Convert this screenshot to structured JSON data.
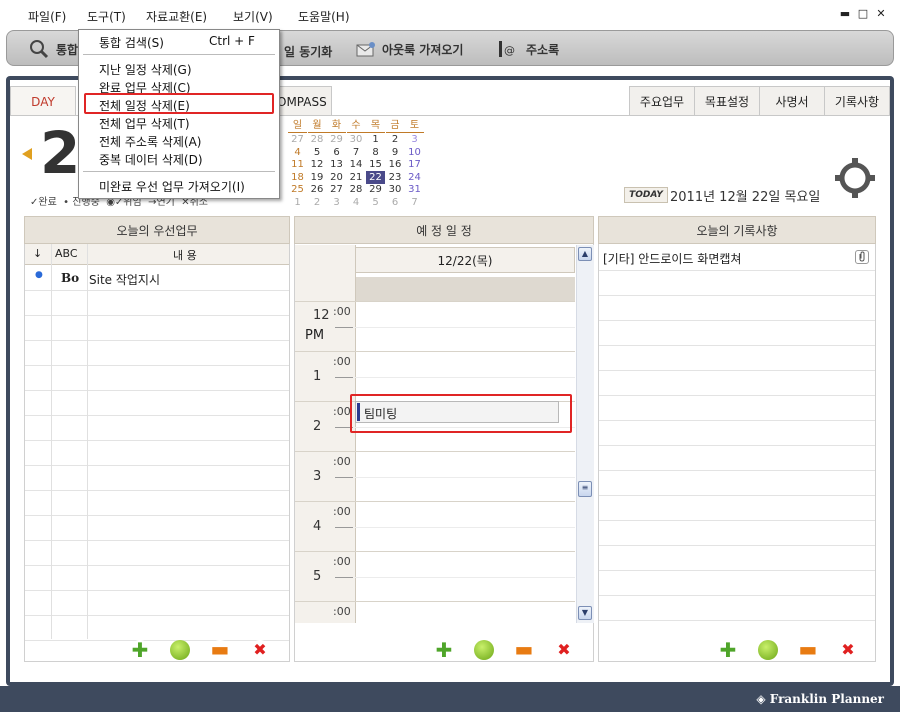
{
  "menubar": {
    "items": [
      "파일(F)",
      "도구(T)",
      "자료교환(E)",
      "보기(V)",
      "도움말(H)"
    ]
  },
  "window_controls": {
    "minimize": "▬",
    "maximize": "□",
    "close": "✕"
  },
  "toolbar": {
    "items": [
      {
        "label": "통합",
        "icon": "search-icon"
      },
      {
        "label": "일 동기화",
        "icon": "sync-icon"
      },
      {
        "label": "아웃룩 가져오기",
        "icon": "outlook-icon"
      },
      {
        "label": "주소록",
        "icon": "address-book-icon"
      }
    ]
  },
  "tools_menu": {
    "items": [
      {
        "label": "통합 검색(S)",
        "shortcut": "Ctrl + F"
      },
      {
        "label": "지난 일정 삭제(G)"
      },
      {
        "label": "완료 업무 삭제(C)"
      },
      {
        "label": "전체 일정 삭제(E)",
        "highlighted": true
      },
      {
        "label": "전체 업무 삭제(T)"
      },
      {
        "label": "전체 주소록 삭제(A)"
      },
      {
        "label": "중복 데이터 삭제(D)"
      },
      {
        "label": "미완료 우선 업무 가져오기(I)"
      }
    ]
  },
  "tabs": {
    "left": [
      "DAY",
      "OMPASS"
    ],
    "right": [
      "주요업무",
      "목표설정",
      "사명서",
      "기록사항"
    ]
  },
  "date_header": {
    "big_day": "2",
    "today_badge": "TODAY",
    "today_text": "2011년 12월 22일 목요일"
  },
  "mini_calendar": {
    "weekdays": [
      "일",
      "월",
      "화",
      "수",
      "목",
      "금",
      "토"
    ],
    "rows": [
      [
        "27",
        "28",
        "29",
        "30",
        "1",
        "2",
        "3"
      ],
      [
        "4",
        "5",
        "6",
        "7",
        "8",
        "9",
        "10"
      ],
      [
        "11",
        "12",
        "13",
        "14",
        "15",
        "16",
        "17"
      ],
      [
        "18",
        "19",
        "20",
        "21",
        "22",
        "23",
        "24"
      ],
      [
        "25",
        "26",
        "27",
        "28",
        "29",
        "30",
        "31"
      ],
      [
        "1",
        "2",
        "3",
        "4",
        "5",
        "6",
        "7"
      ]
    ],
    "selected": "22"
  },
  "status_legend": {
    "items": [
      "✓완료",
      "• 진행중",
      "◉✓위임",
      "→연기",
      "✕취소"
    ]
  },
  "priority_tasks": {
    "title": "오늘의 우선업무",
    "columns": [
      "↓",
      "ABC",
      "내 용"
    ],
    "rows": [
      {
        "status": "●",
        "abc": "Bo",
        "content": "Site 작업지시"
      }
    ]
  },
  "schedule": {
    "title": "예 정 일 정",
    "date_header": "12/22(목)",
    "hours": [
      {
        "hour": "12",
        "ampm": "PM",
        "min": ":00"
      },
      {
        "hour": "1",
        "ampm": "",
        "min": ":00"
      },
      {
        "hour": "2",
        "ampm": "",
        "min": ":00"
      },
      {
        "hour": "3",
        "ampm": "",
        "min": ":00"
      },
      {
        "hour": "4",
        "ampm": "",
        "min": ":00"
      },
      {
        "hour": "5",
        "ampm": "",
        "min": ":00"
      },
      {
        "hour": "",
        "ampm": "",
        "min": ":00"
      }
    ],
    "event": {
      "title": "팀미팅"
    }
  },
  "records": {
    "title": "오늘의 기록사항",
    "items": [
      {
        "text": "[기타] 안드로이드 화면캡쳐",
        "attachment": true
      }
    ]
  },
  "buttons": {
    "add": "✚",
    "mark": "●",
    "remove": "▬",
    "delete": "✖"
  },
  "brand": "Franklin Planner"
}
